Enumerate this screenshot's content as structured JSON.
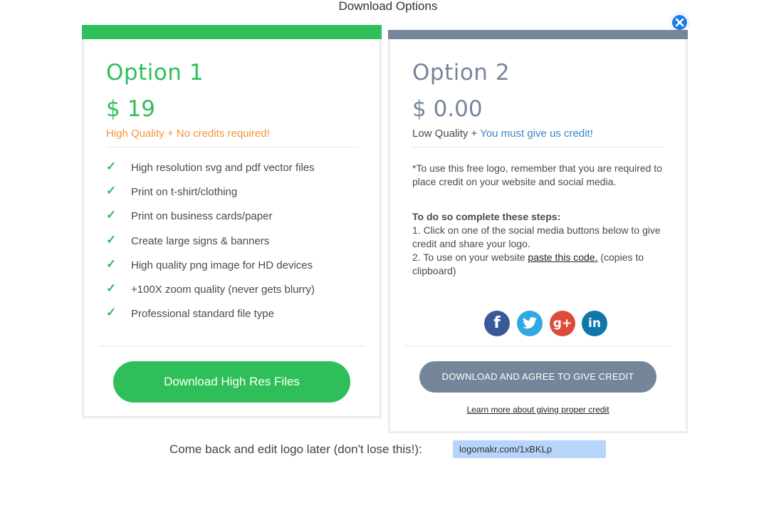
{
  "dialog": {
    "title": "Download Options"
  },
  "option1": {
    "title": "Option 1",
    "price": "$ 19",
    "quality_label": "High Quality + No credits required!",
    "features": [
      "High resolution svg and pdf vector files",
      "Print on t-shirt/clothing",
      "Print on business cards/paper",
      "Create large signs & banners",
      "High quality png image for HD devices",
      "+100X zoom quality (never gets blurry)",
      "Professional standard file type"
    ],
    "button_label": "Download High Res Files"
  },
  "option2": {
    "title": "Option 2",
    "price": "$ 0.00",
    "quality_prefix": "Low Quality + ",
    "quality_highlight": "You must give us credit!",
    "note_intro": "*To use this free logo, remember that you are required to place credit on your website and social media.",
    "steps_heading": "To do so complete these steps:",
    "step1": "1. Click on one of the social media buttons below to give credit and share your logo.",
    "step2_prefix": "2. To use on your website ",
    "step2_link": "paste this code.",
    "step2_suffix": " (copies to clipboard)",
    "socials": [
      "facebook-icon",
      "twitter-icon",
      "google-plus-icon",
      "linkedin-icon"
    ],
    "button_label": "DOWNLOAD AND AGREE TO GIVE CREDIT",
    "learn_more": "Learn more about giving proper credit"
  },
  "footer": {
    "label": "Come back and edit logo later (don't lose this!):",
    "link_value": "logomakr.com/1xBKLp"
  },
  "colors": {
    "green": "#2fbf5a",
    "slate": "#76869a",
    "orange": "#f0963a",
    "blue_link": "#3a86c8",
    "close_blue": "#1a7ee6",
    "input_bg": "#b7d5fb"
  }
}
